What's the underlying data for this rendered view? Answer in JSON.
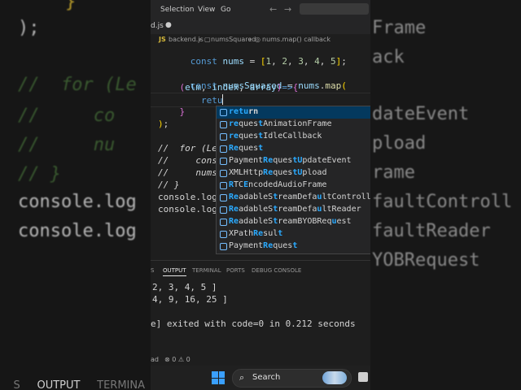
{
  "menu": {
    "selection": "Selection",
    "view": "View",
    "go": "Go"
  },
  "editor_tab": {
    "filename": "d.js"
  },
  "breadcrumb": {
    "lang": "JS",
    "file": "backend.js",
    "symbol": "numsSquared",
    "call": "nums.map() callback"
  },
  "code": {
    "l1": "const nums = [1, 2, 3, 4, 5];",
    "l2": "const numsSquared = nums.map(",
    "l3": "    (elm, index, array)=>{",
    "l4": "        retu",
    "l5": "    }",
    "l6": ");",
    "l7": "//  for (Let",
    "l8": "//     const",
    "l9": "//     numsS",
    "l10": "// }",
    "l11": "console.log(",
    "l12": "console.log("
  },
  "suggestions": [
    "return",
    "requestAnimationFrame",
    "requestIdleCallback",
    "Request",
    "PaymentRequestUpdateEvent",
    "XMLHttpRequestUpload",
    "RTCEncodedAudioFrame",
    "ReadableStreamDefaultControll",
    "ReadableStreamDefaultReader",
    "ReadableStreamBYOBRequest",
    "XPathResult",
    "PaymentRequest"
  ],
  "panel": {
    "tabs": {
      "s": "S",
      "output": "OUTPUT",
      "terminal": "TERMINAL",
      "ports": "PORTS",
      "debug": "DEBUG CONSOLE"
    },
    "out1": "2, 3, 4, 5 ]",
    "out2": "4, 9, 16, 25 ]",
    "out3": "e] exited with code=0 in 0.212 seconds"
  },
  "status": {
    "left": "ad",
    "problems": "⊗ 0 ⚠ 0"
  },
  "taskbar": {
    "search": "Search"
  },
  "backdrop": {
    "left": {
      "l1": ");",
      "l2": "//  for (Le",
      "l3": "//     co",
      "l4": "//     nu",
      "l5": "// }",
      "l6": "console.log",
      "l7": "console.log"
    },
    "right": {
      "r1": "Frame",
      "r2": "ack",
      "r3": "dateEvent",
      "r4": "pload",
      "r5": "rame",
      "r6": "faultControll",
      "r7": "faultReader",
      "r8": "YOBRequest"
    },
    "tabs": {
      "s": "S",
      "output": "OUTPUT",
      "terminal": "TERMINA"
    }
  }
}
